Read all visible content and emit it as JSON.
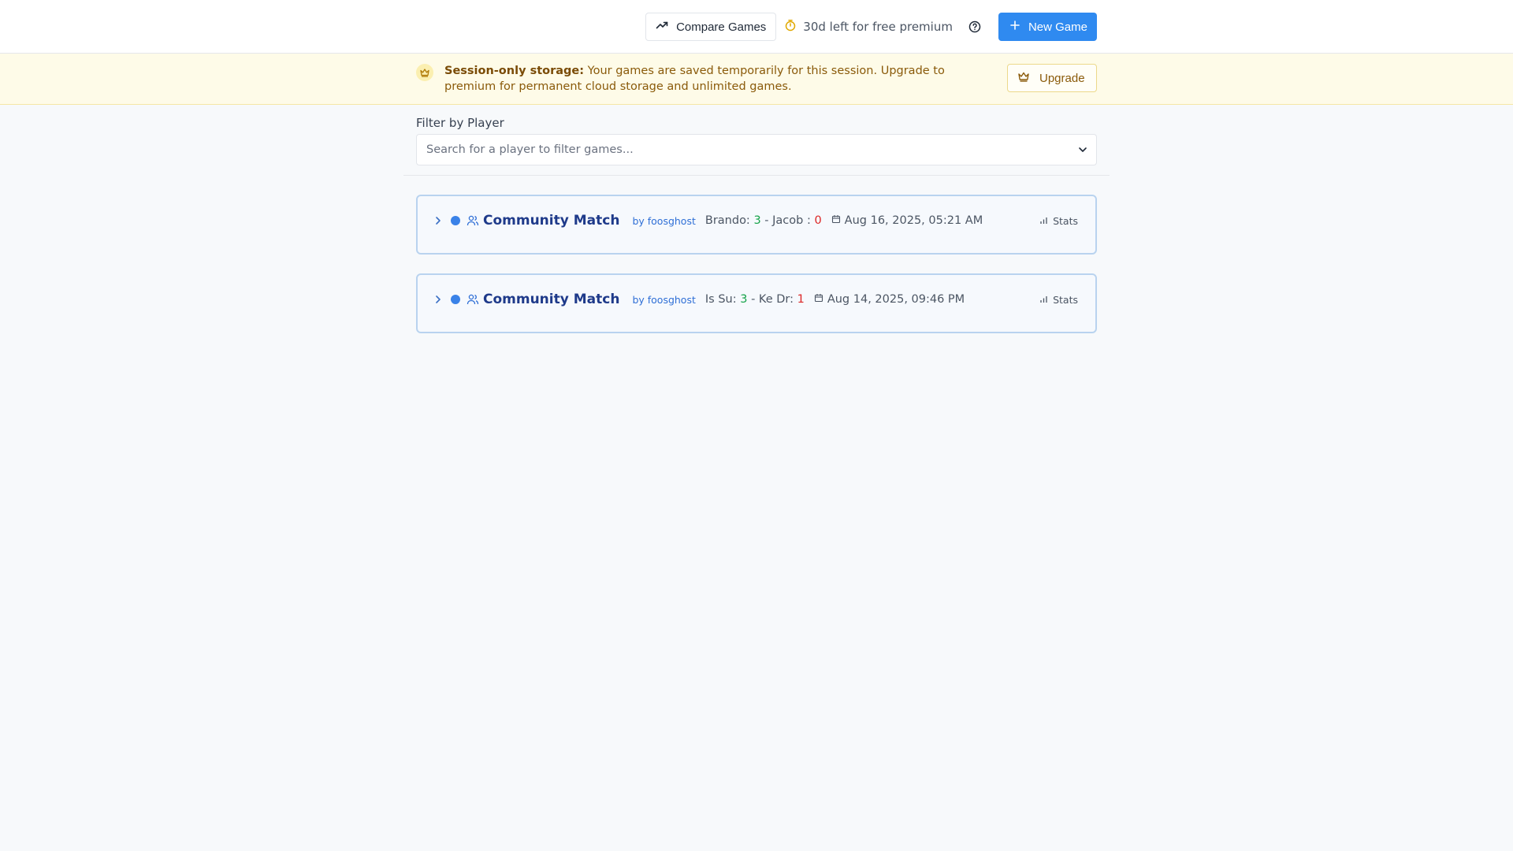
{
  "header": {
    "compare_label": "Compare Games",
    "premium_text": "30d left for free premium",
    "new_game_label": "New Game"
  },
  "banner": {
    "title": "Session-only storage:",
    "message": "Your games are saved temporarily for this session. Upgrade to premium for permanent cloud storage and unlimited games.",
    "upgrade_label": "Upgrade"
  },
  "filter": {
    "label": "Filter by Player",
    "placeholder": "Search for a player to filter games..."
  },
  "games": [
    {
      "title": "Community Match",
      "by": "by foosghost",
      "player1": "Brando:",
      "score1": "3",
      "sep": "- Jacob :",
      "score2": "0",
      "date": "Aug 16, 2025, 05:21 AM",
      "stats_label": "Stats"
    },
    {
      "title": "Community Match",
      "by": "by foosghost",
      "player1": "Is Su:",
      "score1": "3",
      "sep": "- Ke Dr:",
      "score2": "1",
      "date": "Aug 14, 2025, 09:46 PM",
      "stats_label": "Stats"
    }
  ],
  "colors": {
    "primary": "#2f8af0",
    "banner_bg": "#fefbe8",
    "win": "#16a34a",
    "lose": "#dc2626",
    "title": "#1e3a8a"
  }
}
